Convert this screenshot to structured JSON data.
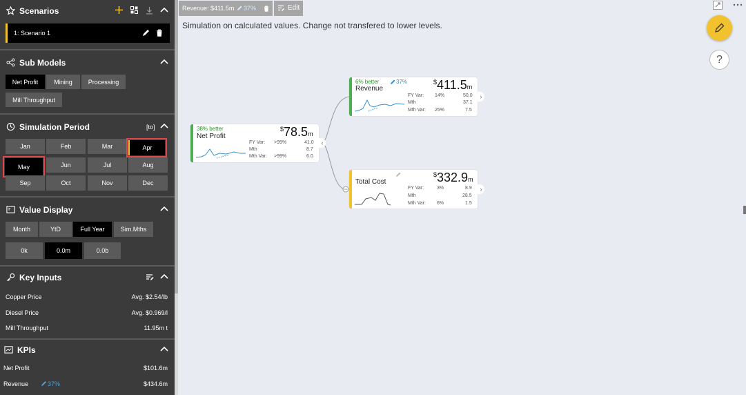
{
  "sidebar": {
    "scenarios": {
      "title": "Scenarios",
      "items": [
        {
          "label": "1: Scenario 1"
        }
      ]
    },
    "sub_models": {
      "title": "Sub Models",
      "buttons": [
        "Net Profit",
        "Mining",
        "Processing",
        "Mill Throughput"
      ],
      "selected": "Net Profit"
    },
    "simulation_period": {
      "title": "Simulation Period",
      "tag": "[to]",
      "months": [
        "Jan",
        "Feb",
        "Mar",
        "Apr",
        "May",
        "Jun",
        "Jul",
        "Aug",
        "Sep",
        "Oct",
        "Nov",
        "Dec"
      ],
      "highlighted": [
        "Apr",
        "May"
      ]
    },
    "value_display": {
      "title": "Value Display",
      "modes": [
        "Month",
        "YtD",
        "Full Year",
        "Sim.Mths"
      ],
      "selected_mode": "Full Year",
      "formats": [
        "0k",
        "0.0m",
        "0.0b"
      ],
      "selected_format": "0.0m"
    },
    "key_inputs": {
      "title": "Key Inputs",
      "rows": [
        {
          "label": "Copper Price",
          "value": "Avg. $2.54/lb"
        },
        {
          "label": "Diesel Price",
          "value": "Avg. $0.969/l"
        },
        {
          "label": "Mill Throughput",
          "value": "11.95m t"
        }
      ]
    },
    "kpis": {
      "title": "KPIs",
      "rows": [
        {
          "label": "Net Profit",
          "value": "$101.6m",
          "badge": ""
        },
        {
          "label": "Revenue",
          "value": "$434.6m",
          "badge": "37%"
        }
      ]
    }
  },
  "main": {
    "toolbar": {
      "chip_text": "Revenue: $411.5m",
      "chip_pct": "37%",
      "edit_label": "Edit"
    },
    "notice": "Simulation on calculated values. Change not transfered to lower levels.",
    "nodes": {
      "net_profit": {
        "better": "38% better",
        "title": "Net Profit",
        "value": "78.5",
        "unit": "m",
        "currency": "$",
        "stats": [
          {
            "label": "FY Var:",
            "pct": ">99%",
            "val": "41.0"
          },
          {
            "label": "Mth",
            "pct": "",
            "val": "8.7"
          },
          {
            "label": "Mth Var:",
            "pct": ">99%",
            "val": "6.0"
          }
        ],
        "color": "#4caf50"
      },
      "revenue": {
        "better": "6% better",
        "pct": "37%",
        "title": "Revenue",
        "value": "411.5",
        "unit": "m",
        "currency": "$",
        "stats": [
          {
            "label": "FY Var:",
            "pct": "14%",
            "val": "50.0"
          },
          {
            "label": "Mth",
            "pct": "",
            "val": "37.1"
          },
          {
            "label": "Mth Var:",
            "pct": "25%",
            "val": "7.5"
          }
        ],
        "color": "#4caf50"
      },
      "total_cost": {
        "title": "Total Cost",
        "value": "332.9",
        "unit": "m",
        "currency": "$",
        "stats": [
          {
            "label": "FY Var:",
            "pct": "3%",
            "val": "8.9"
          },
          {
            "label": "Mth",
            "pct": "",
            "val": "28.5"
          },
          {
            "label": "Mth Var:",
            "pct": "6%",
            "val": "1.5"
          }
        ],
        "color": "#f2c12e"
      }
    },
    "help_glyph": "?"
  },
  "colors": {
    "sidebar_bg": "#3b3b3b",
    "accent_yellow": "#f2c12e",
    "highlight_red": "#e0464a",
    "positive_green": "#4caf50",
    "link_blue": "#4aa3df"
  }
}
